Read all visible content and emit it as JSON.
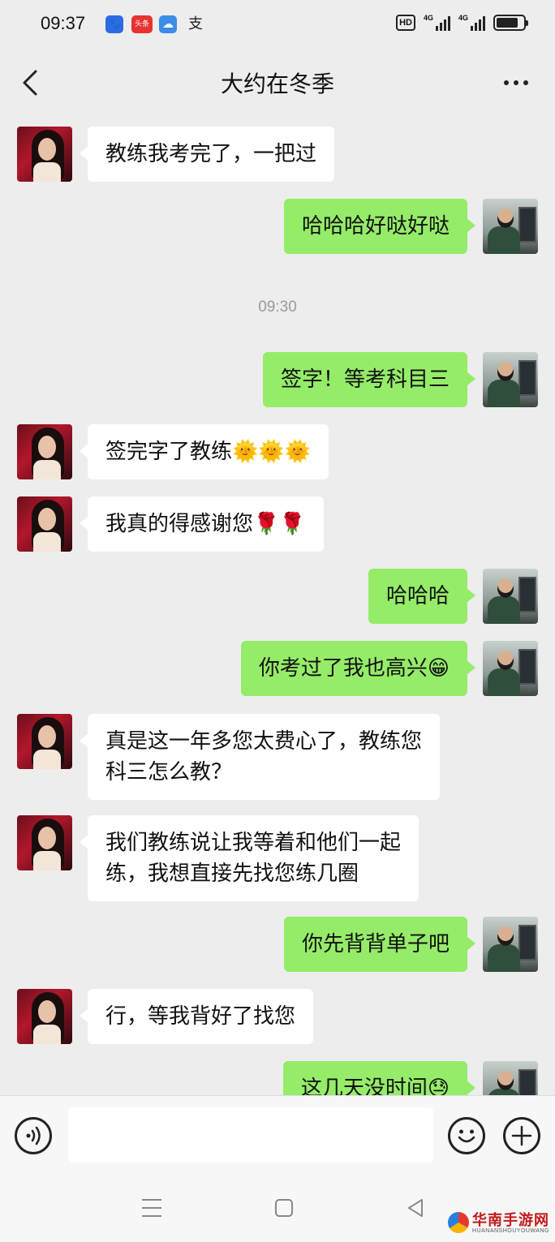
{
  "status_bar": {
    "time": "09:37",
    "app_icons": [
      {
        "icon": "baidu-paw-icon",
        "color": "#2d6be4",
        "glyph": "🐾"
      },
      {
        "icon": "toutiao-icon",
        "color": "#e8322f",
        "glyph": "头条"
      },
      {
        "icon": "cloud-icon",
        "color": "#3b8de6",
        "glyph": "☁"
      },
      {
        "icon": "alipay-icon",
        "color": "#222222",
        "glyph": "支"
      }
    ],
    "hd_label": "HD",
    "network_1": "4G",
    "network_2": "4G",
    "battery_level": 0.82
  },
  "header": {
    "title": "大约在冬季"
  },
  "messages": [
    {
      "side": "left",
      "lines": [
        "教练我考完了，一把过"
      ]
    },
    {
      "side": "right",
      "lines": [
        "哈哈哈好哒好哒"
      ]
    },
    {
      "type": "timestamp",
      "text": "09:30"
    },
    {
      "side": "right",
      "lines": [
        "签字！等考科目三"
      ]
    },
    {
      "side": "left",
      "lines": [
        "签完字了教练🌞🌞🌞"
      ]
    },
    {
      "side": "left",
      "lines": [
        "我真的得感谢您🌹🌹"
      ]
    },
    {
      "side": "right",
      "lines": [
        "哈哈哈"
      ]
    },
    {
      "side": "right",
      "lines": [
        "你考过了我也高兴😁"
      ]
    },
    {
      "side": "left",
      "lines": [
        "真是这一年多您太费心了，教练您",
        "科三怎么教？"
      ]
    },
    {
      "side": "left",
      "lines": [
        "我们教练说让我等着和他们一起",
        "练，我想直接先找您练几圈"
      ]
    },
    {
      "side": "right",
      "lines": [
        "你先背背单子吧"
      ]
    },
    {
      "side": "left",
      "lines": [
        "行，等我背好了找您"
      ]
    },
    {
      "side": "right",
      "lines": [
        "这几天没时间😓"
      ]
    }
  ],
  "input_bar": {
    "voice_icon": "voice-icon",
    "emoji_icon": "emoji-icon",
    "plus_icon": "plus-icon",
    "value": ""
  },
  "nav_bar": {
    "menu_icon": "menu-icon",
    "home_icon": "home-icon",
    "back_icon": "back-triangle-icon"
  },
  "watermark": {
    "title": "华南手游网",
    "subtitle": "HUANANSHOUYOUWANG"
  }
}
